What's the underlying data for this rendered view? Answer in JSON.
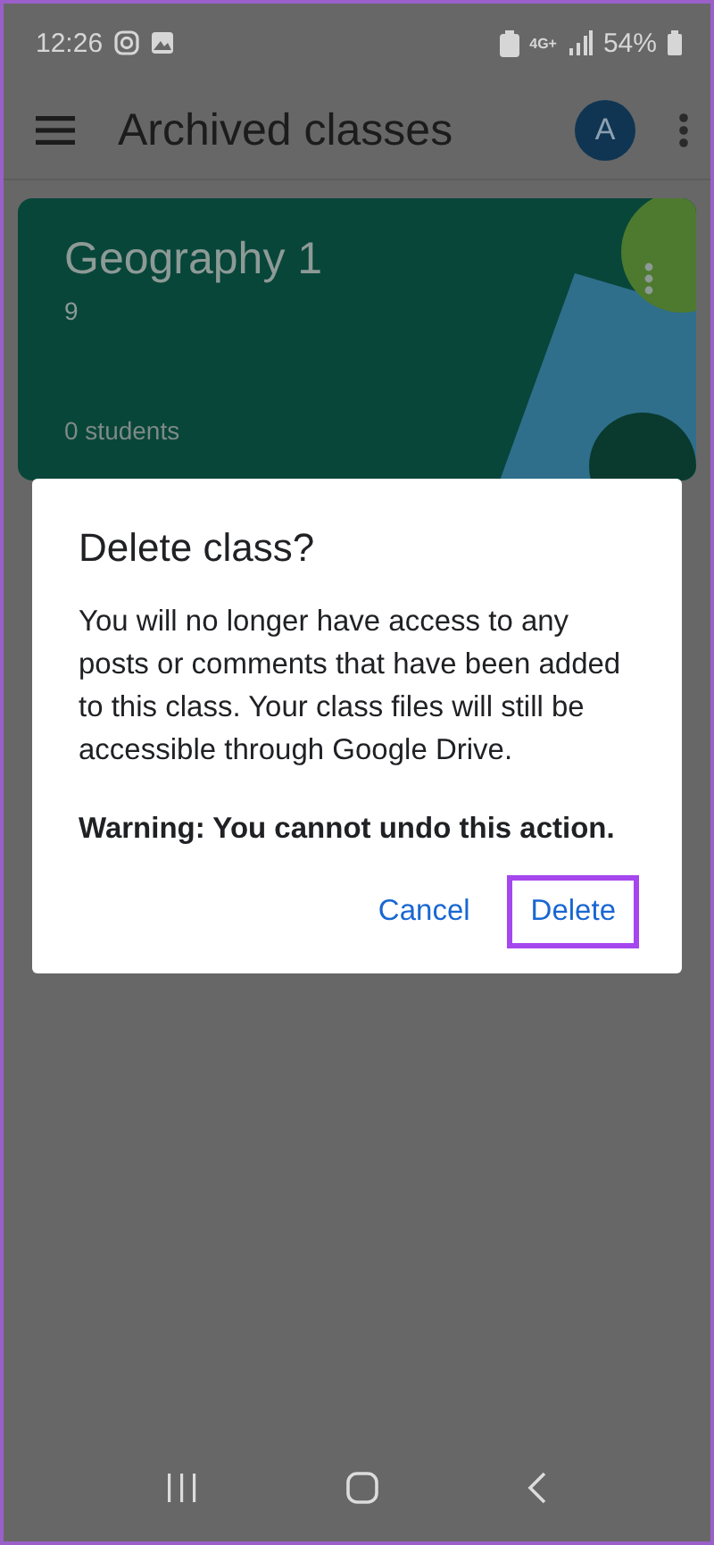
{
  "status_bar": {
    "time": "12:26",
    "network": "4G+",
    "battery": "54%"
  },
  "app_bar": {
    "title": "Archived classes",
    "avatar": "A"
  },
  "classes": [
    {
      "name": "Geography 1",
      "section": "9",
      "students": "0 students"
    }
  ],
  "dialog": {
    "title": "Delete class?",
    "message": "You will no longer have access to any posts or comments that have been added to this class. Your class files will still be accessible through Google Drive.",
    "warning": "Warning: You cannot undo this action.",
    "buttons": [
      {
        "label": "Cancel",
        "highlighted": false
      },
      {
        "label": "Delete",
        "highlighted": true
      }
    ]
  }
}
